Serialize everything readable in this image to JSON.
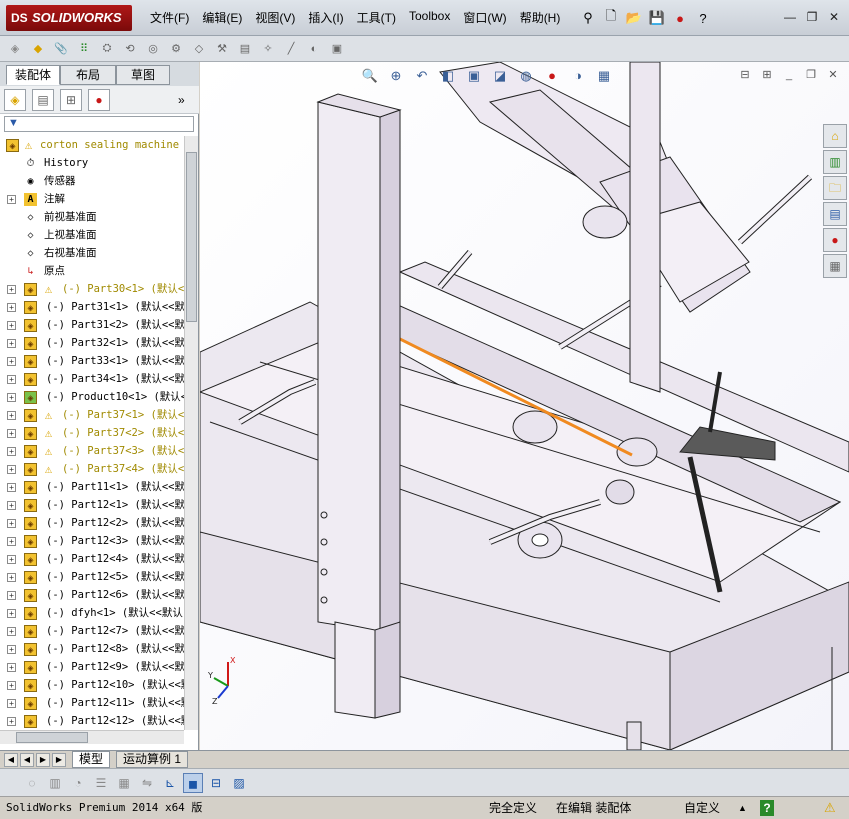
{
  "app": {
    "logo": "SOLIDWORKS",
    "logo_mark": "DS"
  },
  "menu": [
    "文件(F)",
    "编辑(E)",
    "视图(V)",
    "插入(I)",
    "工具(T)",
    "Toolbox",
    "窗口(W)",
    "帮助(H)"
  ],
  "tabs": [
    "装配体",
    "布局",
    "草图"
  ],
  "filter_label": "▼",
  "tree": {
    "root": "corton sealing machine",
    "items": [
      {
        "label": "History",
        "icon": "history-icon",
        "exp": false,
        "warn": false
      },
      {
        "label": "传感器",
        "icon": "sensor-icon",
        "exp": false,
        "warn": false
      },
      {
        "label": "注解",
        "icon": "annotation-icon",
        "exp": true,
        "warn": false
      },
      {
        "label": "前视基准面",
        "icon": "plane-icon",
        "exp": false,
        "warn": false
      },
      {
        "label": "上视基准面",
        "icon": "plane-icon",
        "exp": false,
        "warn": false
      },
      {
        "label": "右视基准面",
        "icon": "plane-icon",
        "exp": false,
        "warn": false
      },
      {
        "label": "原点",
        "icon": "origin-icon",
        "exp": false,
        "warn": false
      },
      {
        "label": "(-) Part30<1> (默认<",
        "icon": "part-icon",
        "exp": true,
        "warn": true
      },
      {
        "label": "(-) Part31<1> (默认<<默",
        "icon": "part-icon",
        "exp": true,
        "warn": false
      },
      {
        "label": "(-) Part31<2> (默认<<默",
        "icon": "part-icon",
        "exp": true,
        "warn": false
      },
      {
        "label": "(-) Part32<1> (默认<<默",
        "icon": "part-icon",
        "exp": true,
        "warn": false
      },
      {
        "label": "(-) Part33<1> (默认<<默",
        "icon": "part-icon",
        "exp": true,
        "warn": false
      },
      {
        "label": "(-) Part34<1> (默认<<默",
        "icon": "part-icon",
        "exp": true,
        "warn": false
      },
      {
        "label": "(-) Product10<1> (默认<",
        "icon": "assembly-icon",
        "exp": true,
        "warn": false
      },
      {
        "label": "(-) Part37<1> (默认<",
        "icon": "part-icon",
        "exp": true,
        "warn": true
      },
      {
        "label": "(-) Part37<2> (默认<",
        "icon": "part-icon",
        "exp": true,
        "warn": true
      },
      {
        "label": "(-) Part37<3> (默认<",
        "icon": "part-icon",
        "exp": true,
        "warn": true
      },
      {
        "label": "(-) Part37<4> (默认<",
        "icon": "part-icon",
        "exp": true,
        "warn": true
      },
      {
        "label": "(-) Part11<1> (默认<<默",
        "icon": "part-icon",
        "exp": true,
        "warn": false
      },
      {
        "label": "(-) Part12<1> (默认<<默",
        "icon": "part-icon",
        "exp": true,
        "warn": false
      },
      {
        "label": "(-) Part12<2> (默认<<默",
        "icon": "part-icon",
        "exp": true,
        "warn": false
      },
      {
        "label": "(-) Part12<3> (默认<<默",
        "icon": "part-icon",
        "exp": true,
        "warn": false
      },
      {
        "label": "(-) Part12<4> (默认<<默",
        "icon": "part-icon",
        "exp": true,
        "warn": false
      },
      {
        "label": "(-) Part12<5> (默认<<默",
        "icon": "part-icon",
        "exp": true,
        "warn": false
      },
      {
        "label": "(-) Part12<6> (默认<<默",
        "icon": "part-icon",
        "exp": true,
        "warn": false
      },
      {
        "label": "(-) dfyh<1> (默认<<默认",
        "icon": "part-icon",
        "exp": true,
        "warn": false
      },
      {
        "label": "(-) Part12<7> (默认<<默",
        "icon": "part-icon",
        "exp": true,
        "warn": false
      },
      {
        "label": "(-) Part12<8> (默认<<默",
        "icon": "part-icon",
        "exp": true,
        "warn": false
      },
      {
        "label": "(-) Part12<9> (默认<<默",
        "icon": "part-icon",
        "exp": true,
        "warn": false
      },
      {
        "label": "(-) Part12<10> (默认<<默",
        "icon": "part-icon",
        "exp": true,
        "warn": false
      },
      {
        "label": "(-) Part12<11> (默认<<默",
        "icon": "part-icon",
        "exp": true,
        "warn": false
      },
      {
        "label": "(-) Part12<12> (默认<<默",
        "icon": "part-icon",
        "exp": true,
        "warn": false
      }
    ]
  },
  "bottom_tabs": [
    "模型",
    "运动算例 1"
  ],
  "status": {
    "product": "SolidWorks Premium 2014 x64 版",
    "definition": "完全定义",
    "editing": "在编辑 装配体",
    "units": "自定义",
    "help": "?"
  },
  "triad": {
    "x": "X",
    "y": "Y",
    "z": "Z"
  },
  "colors": {
    "logo": "#b01818",
    "selection": "#f08a20",
    "part_icon": "#f2c230"
  }
}
